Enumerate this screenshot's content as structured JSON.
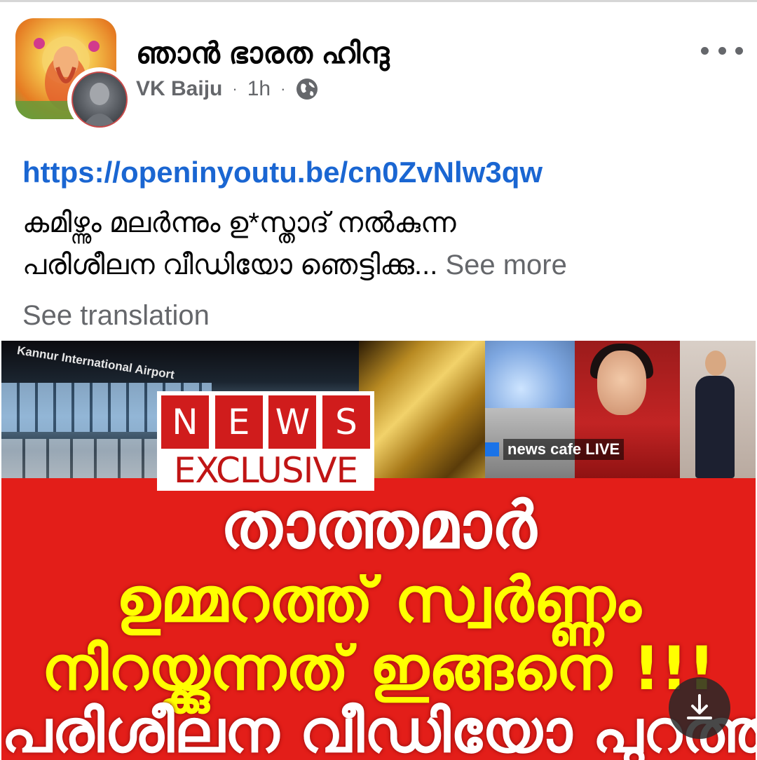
{
  "post": {
    "group_name": "ഞാൻ ഭാരത ഹിന്ദു",
    "author": "VK Baiju",
    "separator": "·",
    "time": "1h",
    "link": "https://openinyoutu.be/cn0ZvNlw3qw",
    "text_line1": "കമിഴ്ന്നും മലർന്നും ഉ*സ്താദ് നൽകുന്ന",
    "text_line2": "പരിശീലന വീഡിയോ ഞെട്ടിക്കു...",
    "see_more": " See more",
    "see_translation": "See translation"
  },
  "media": {
    "airport_label": "Kannur International Airport",
    "news_letters": [
      "N",
      "E",
      "W",
      "S"
    ],
    "exclusive": "EXCLUSIVE",
    "cafe_tag": "news cafe LIVE",
    "headline1": "താത്തമാർ",
    "headline2": "ഉമ്മറത്ത് സ്വർണ്ണം",
    "headline3": "നിറയ്ക്കുന്നത് ഇങ്ങനെ !!!",
    "headline4": "പരിശീലന വീഡിയോ പുറത്ത്"
  },
  "icons": {
    "more": "more-horizontal-icon",
    "privacy": "globe-icon",
    "download": "download-icon"
  },
  "colors": {
    "link": "#1a66d2",
    "secondary_text": "#65676b",
    "banner_red": "#e31e19",
    "headline_yellow": "#ffff00"
  }
}
